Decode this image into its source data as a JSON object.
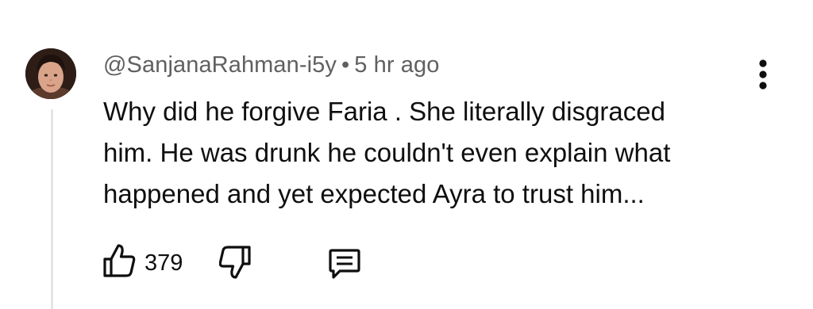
{
  "comment": {
    "author": "@SanjanaRahman-i5y",
    "separator": "•",
    "time_ago": "5 hr ago",
    "text_lines": [
      "Why did he forgive Faria . She literally disgraced",
      "him. He was drunk he couldn't even explain what",
      "happened and yet expected Ayra to trust him..."
    ],
    "like_count": "379"
  },
  "icons": {
    "avatar": "user-avatar",
    "more": "more-vertical-icon",
    "like": "thumbs-up-icon",
    "dislike": "thumbs-down-icon",
    "reply": "reply-comment-icon"
  },
  "colors": {
    "meta_text": "#606060",
    "text": "#0f0f0f",
    "thread_line": "#e5e5e5"
  }
}
